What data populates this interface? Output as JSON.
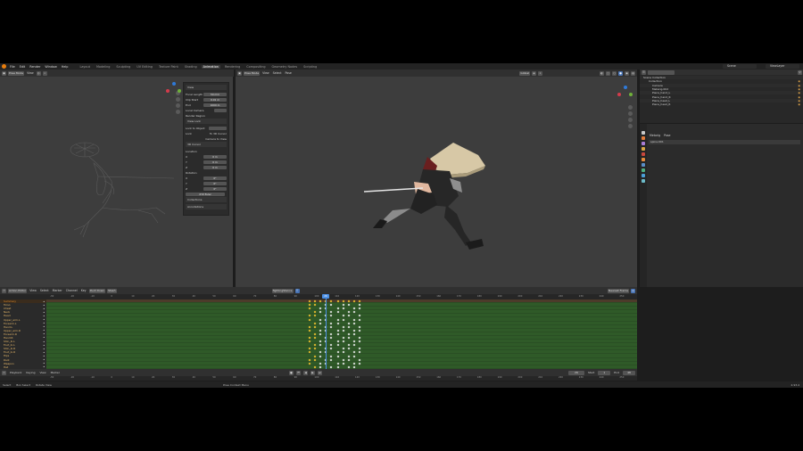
{
  "topbar": {
    "menus": [
      "File",
      "Edit",
      "Render",
      "Window",
      "Help"
    ],
    "workspaces": [
      {
        "label": "Layout",
        "active": false
      },
      {
        "label": "Modeling",
        "active": false
      },
      {
        "label": "Sculpting",
        "active": false
      },
      {
        "label": "UV Editing",
        "active": false
      },
      {
        "label": "Texture Paint",
        "active": false
      },
      {
        "label": "Shading",
        "active": false
      },
      {
        "label": "Animation",
        "active": true
      },
      {
        "label": "Rendering",
        "active": false
      },
      {
        "label": "Compositing",
        "active": false
      },
      {
        "label": "Geometry Nodes",
        "active": false
      },
      {
        "label": "Scripting",
        "active": false
      }
    ],
    "scene": "Scene",
    "view_layer": "ViewLayer"
  },
  "left_viewport": {
    "header": {
      "mode": "Pose Mode",
      "view": "View"
    },
    "npanel": {
      "section_view": "View",
      "focal_label": "Focal Length",
      "focal_value": "50 mm",
      "clip_start_label": "Clip Start",
      "clip_start_value": "0.01 m",
      "end_label": "End",
      "end_value": "1000 m",
      "local_camera_label": "Local Camera",
      "render_region_label": "Render Region",
      "view_lock_label": "View Lock",
      "lock_to_object_label": "Lock to Object",
      "lock_label": "Lock",
      "to_3d_cursor_label": "To 3D Cursor",
      "to_camera_view_label": "Camera to View",
      "cursor_section": "3D Cursor",
      "location_label": "Location",
      "rotation_label": "Rotation",
      "axes": [
        "X",
        "Y",
        "Z"
      ],
      "location_values": [
        "0 m",
        "0 m",
        "0 m"
      ],
      "rotation_values": [
        "0°",
        "0°",
        "0°"
      ],
      "rotation_mode": "XYZ Euler",
      "collections_label": "Collections",
      "annotations_label": "Annotations"
    }
  },
  "right_viewport": {
    "header": {
      "mode": "Pose Mode",
      "menus": [
        "View",
        "Select",
        "Pose"
      ],
      "transform": "Global"
    }
  },
  "outliner": {
    "title": "Scene Collection",
    "rows": [
      {
        "name": "Collection"
      },
      {
        "name": "Camera"
      },
      {
        "name": "Metarig.002"
      },
      {
        "name": "Piece_hand_L"
      },
      {
        "name": "Piece_hand_R"
      },
      {
        "name": "Piece_head_L"
      },
      {
        "name": "Piece_head_R"
      }
    ]
  },
  "properties": {
    "bone_label": "Metarig",
    "pose_label": "Pose",
    "bone_field": "spine.001"
  },
  "dopesheet": {
    "header": {
      "mode": "Action Editor",
      "menus": [
        "View",
        "Select",
        "Marker",
        "Channel",
        "Key"
      ],
      "push_down": "Push Down",
      "stash": "Stash",
      "action": "fightingStance",
      "snap": "Nearest Frame"
    },
    "frame_ticks": [
      "-30",
      "-20",
      "-10",
      "0",
      "10",
      "20",
      "30",
      "40",
      "50",
      "60",
      "70",
      "80",
      "90",
      "100",
      "110",
      "120",
      "130",
      "140",
      "150",
      "160",
      "170",
      "180",
      "190",
      "200",
      "210",
      "220",
      "230",
      "240",
      "250"
    ],
    "current_frame": "26",
    "channels": [
      {
        "name": "Summary",
        "summary": true
      },
      {
        "name": "Torso"
      },
      {
        "name": "Chest"
      },
      {
        "name": "Neck"
      },
      {
        "name": "Head"
      },
      {
        "name": "Upper_arm.L"
      },
      {
        "name": "Forearm.L"
      },
      {
        "name": "Hand.L"
      },
      {
        "name": "Upper_arm.R"
      },
      {
        "name": "Forearm.R"
      },
      {
        "name": "Hand.R"
      },
      {
        "name": "Shin_ik.L"
      },
      {
        "name": "Foot_ik.L"
      },
      {
        "name": "Shin_ik.R"
      },
      {
        "name": "Foot_ik.R"
      },
      {
        "name": "Hips"
      },
      {
        "name": "Root"
      },
      {
        "name": "Weapon"
      },
      {
        "name": "Hat"
      }
    ]
  },
  "playback": {
    "menus": [
      "Playback",
      "Keying",
      "View",
      "Marker"
    ],
    "start_label": "Start",
    "start_value": "1",
    "end_label": "End",
    "end_value": "48"
  },
  "statusbar": {
    "items": [
      "Select",
      "Box Select",
      "Rotate View",
      "Pose Context Menu"
    ],
    "version": "2.93.4"
  },
  "colors": {
    "accent": "#4772b3",
    "track_green": "#2f5a28",
    "keyframe_selected": "#f2c230",
    "playhead": "#4b8fe4"
  }
}
